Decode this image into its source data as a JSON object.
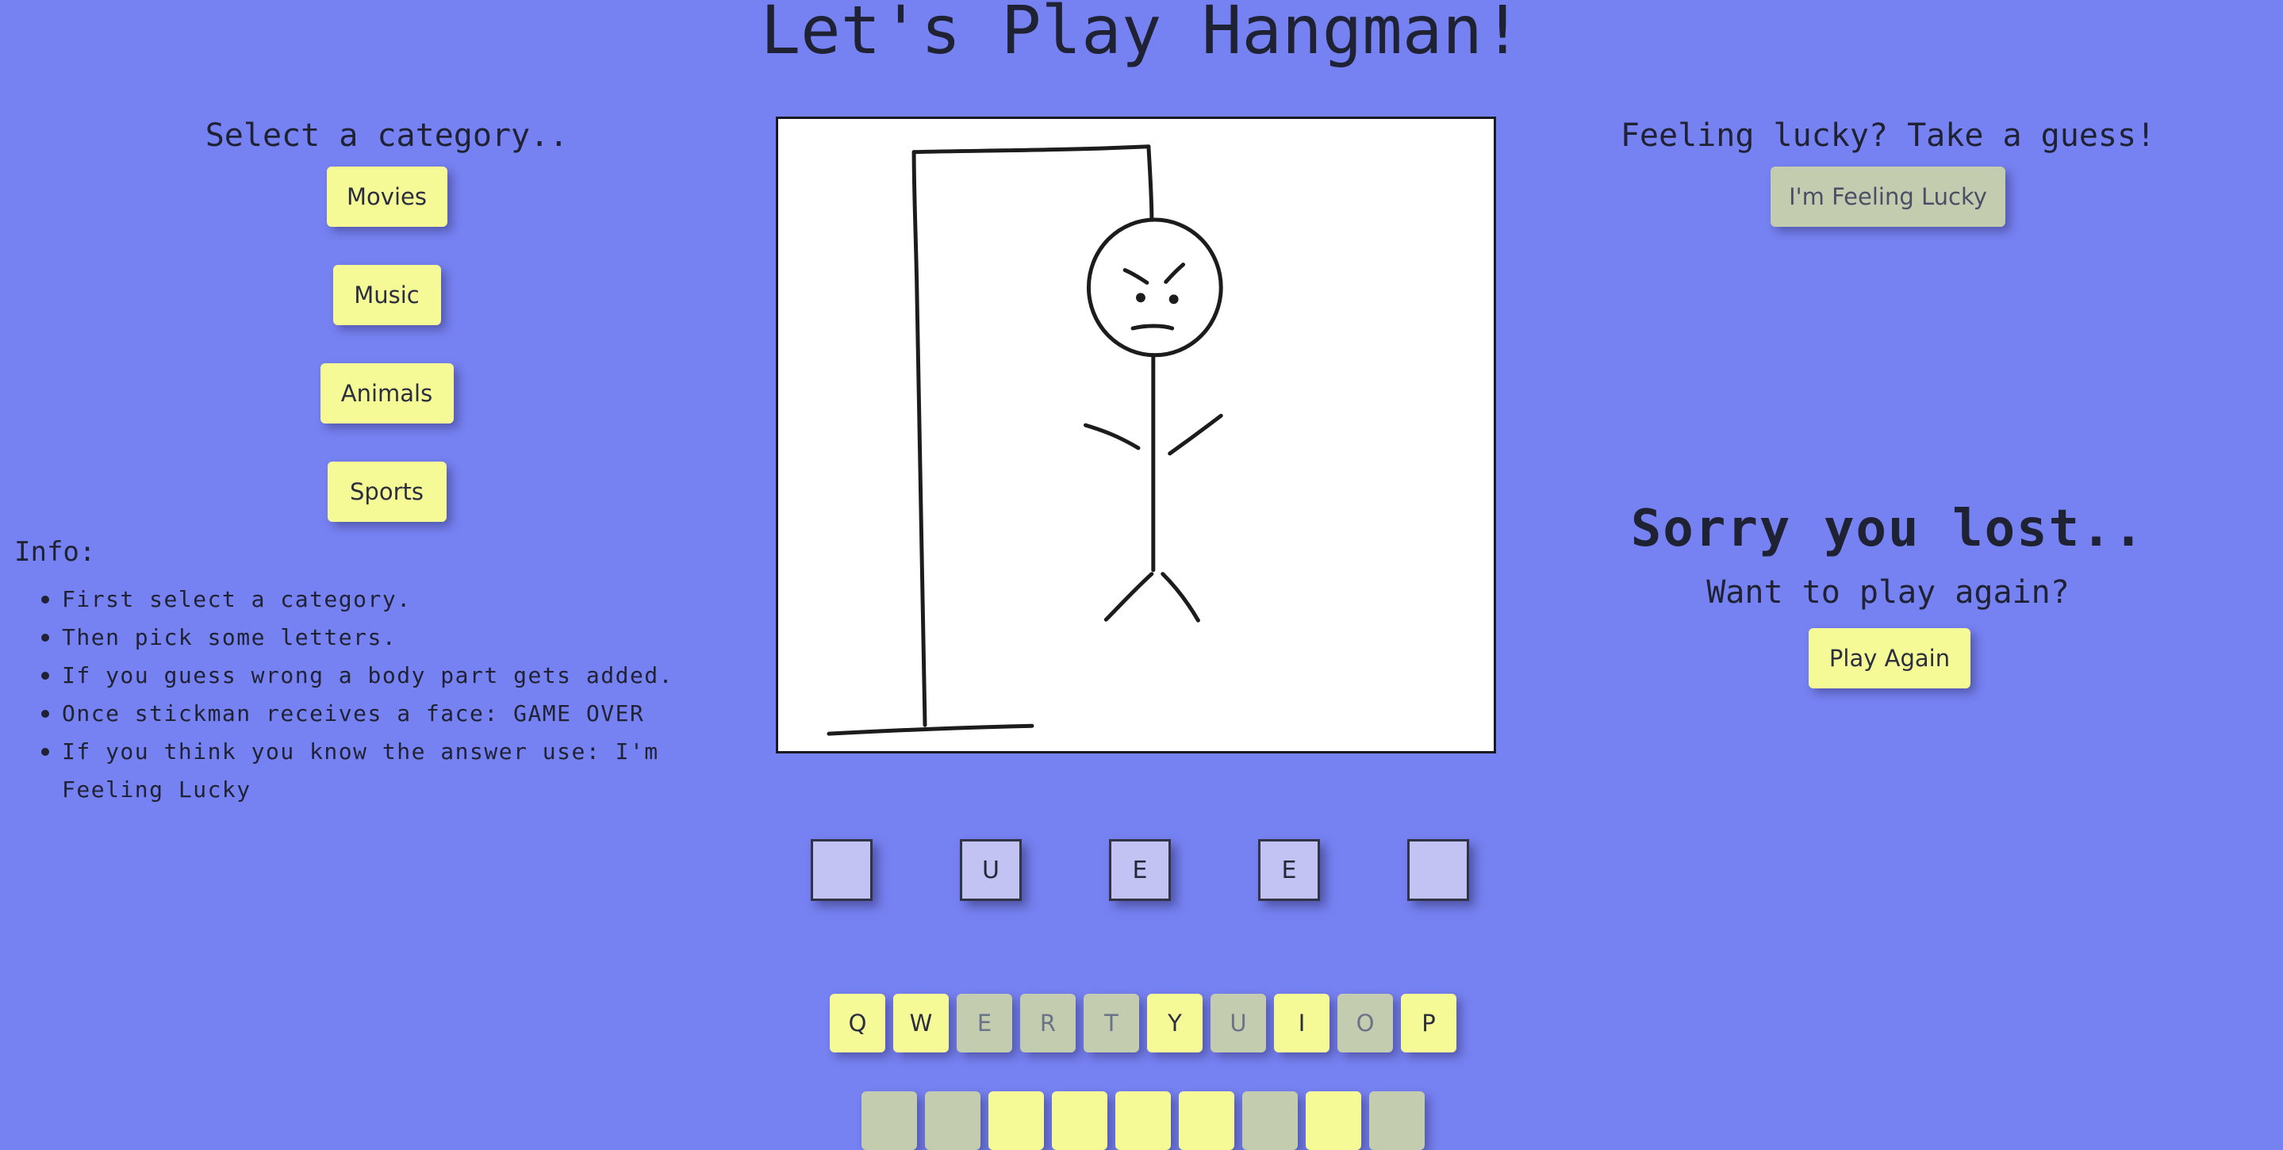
{
  "page_title": "Let's Play Hangman!",
  "categories": {
    "heading": "Select a category..",
    "buttons": [
      "Movies",
      "Music",
      "Animals",
      "Sports"
    ]
  },
  "info": {
    "heading": "Info:",
    "items": [
      "First select a category.",
      "Then pick some letters.",
      "If you guess wrong a body part gets added.",
      "Once stickman receives a face: GAME OVER",
      "If you think you know the answer use: I'm Feeling Lucky"
    ]
  },
  "lucky": {
    "heading": "Feeling lucky? Take a guess!",
    "button": "I'm Feeling Lucky"
  },
  "result": {
    "heading": "Sorry you lost..",
    "subheading": "Want to play again?",
    "button": "Play Again"
  },
  "word_tiles": [
    "",
    "U",
    "E",
    "E",
    ""
  ],
  "keyboard": {
    "row1": [
      {
        "letter": "Q",
        "used": false
      },
      {
        "letter": "W",
        "used": false
      },
      {
        "letter": "E",
        "used": true
      },
      {
        "letter": "R",
        "used": true
      },
      {
        "letter": "T",
        "used": true
      },
      {
        "letter": "Y",
        "used": false
      },
      {
        "letter": "U",
        "used": true
      },
      {
        "letter": "I",
        "used": false
      },
      {
        "letter": "O",
        "used": true
      },
      {
        "letter": "P",
        "used": false
      }
    ]
  },
  "colors": {
    "background": "#7782f2",
    "button": "#f5fa97",
    "button_disabled": "#c4ccb0",
    "tile": "#c3c3f3"
  }
}
